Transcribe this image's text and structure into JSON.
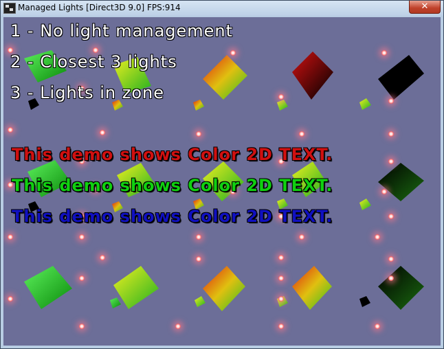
{
  "window": {
    "title": "Managed Lights [Direct3D 9.0] FPS:914",
    "close_label": "✕"
  },
  "menu": [
    {
      "text": "1 - No light management"
    },
    {
      "text": "2 - Closest 3 lights"
    },
    {
      "text": "3 - Lights in zone"
    }
  ],
  "demo_text": [
    {
      "text": "This demo shows Color 2D TEXT.",
      "color": "#d01010"
    },
    {
      "text": "This demo shows Color 2D TEXT.",
      "color": "#10d010"
    },
    {
      "text": "This demo shows Color 2D TEXT.",
      "color": "#1010c0"
    }
  ],
  "colors": {
    "viewport_background": "#6c6e98",
    "light_glow": "#ff6a6a"
  }
}
